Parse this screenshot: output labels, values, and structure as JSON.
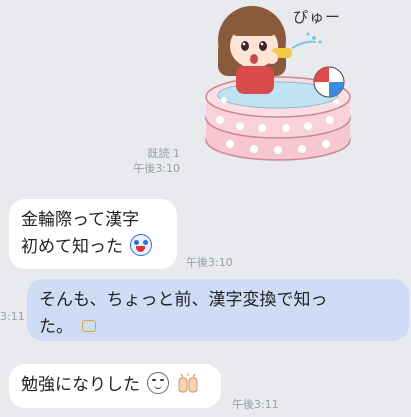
{
  "sticker": {
    "sound_text": "ぴゅー",
    "icon": "girl-in-pool-sticker"
  },
  "messages": [
    {
      "meta_read": "既読 1",
      "meta_time": "午後3:10"
    },
    {
      "line1": "金輪際って漢字",
      "line2": "初めて知った",
      "emoji": "surprised-face-emoji",
      "time": "午後3:10"
    },
    {
      "line1": "そんも、ちょっと前、漢字変換で知っ",
      "line2": "た。",
      "emoji": "sweat-emoji",
      "time_partial": "3:11"
    },
    {
      "text": "勉強になりした",
      "emoji1": "smile-face-emoji",
      "emoji2": "clapping-hands-emoji",
      "time": "午後3:11"
    }
  ],
  "colors": {
    "background": "#e8eaed",
    "incoming_bubble": "#ffffff",
    "outgoing_bubble": "#cfdcf5"
  }
}
